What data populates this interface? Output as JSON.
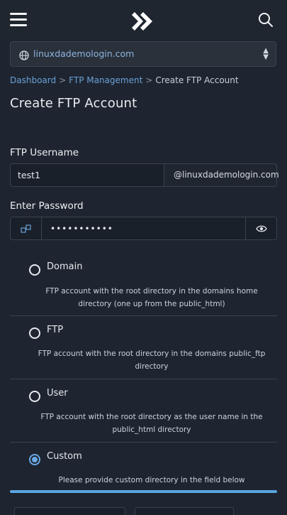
{
  "header": {
    "menu_icon": "hamburger-menu-icon",
    "logo_icon": "double-chevron-logo-icon",
    "search_icon": "search-icon"
  },
  "domain_selector": {
    "value": "linuxdademologin.com",
    "icon": "globe-icon"
  },
  "breadcrumb": {
    "items": [
      "Dashboard",
      "FTP Management"
    ],
    "current": "Create FTP Account",
    "separator": ">"
  },
  "page": {
    "title": "Create FTP Account"
  },
  "username": {
    "label": "FTP Username",
    "value": "test1",
    "suffix": "@linuxdademologin.com"
  },
  "password": {
    "label": "Enter Password",
    "value": "•••••••••••",
    "generate_icon": "key-generate-icon",
    "toggle_icon": "eye-icon"
  },
  "directory_options": [
    {
      "label": "Domain",
      "description": "FTP account with the root directory in the domains home directory (one up from the public_html)",
      "selected": false
    },
    {
      "label": "FTP",
      "description": "FTP account with the root directory in the domains public_ftp directory",
      "selected": false
    },
    {
      "label": "User",
      "description": "FTP account with the root directory as the user name in the public_html directory",
      "selected": false
    },
    {
      "label": "Custom",
      "description": "Please provide custom directory in the field below",
      "selected": true
    }
  ],
  "colors": {
    "background": "#1e2530",
    "accent": "#6aa8e4",
    "link": "#6aa0d6"
  }
}
